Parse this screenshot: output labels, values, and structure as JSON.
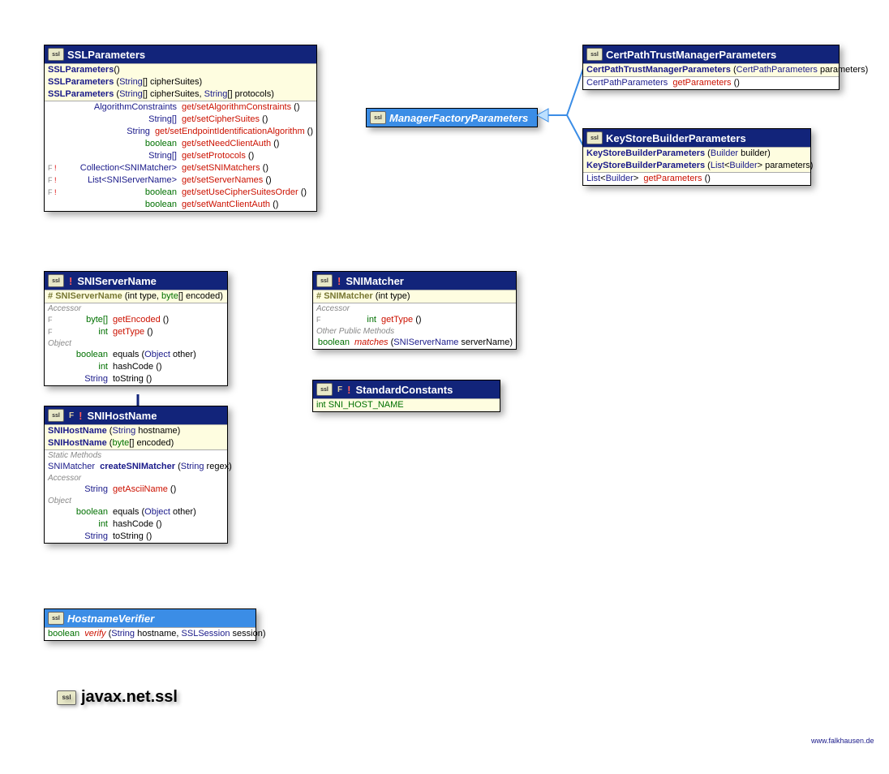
{
  "package": "javax.net.ssl",
  "siteLink": "www.falkhausen.de",
  "classes": {
    "sslParameters": {
      "title": "SSLParameters",
      "constructors": [
        {
          "name": "SSLParameters",
          "params": "()"
        },
        {
          "name": "SSLParameters",
          "params": "(String[] cipherSuites)",
          "p1": "(",
          "t1": "String",
          "p2": "[] cipherSuites)"
        },
        {
          "name": "SSLParameters",
          "params": "(String[] cipherSuites, String[] protocols)",
          "p1": "(",
          "t1": "String",
          "p2": "[] cipherSuites, ",
          "t2": "String",
          "p3": "[] protocols)"
        }
      ],
      "methods": [
        {
          "flags": "",
          "ret": "AlgorithmConstraints",
          "retClass": "link",
          "name": "get/setAlgorithmConstraints",
          "paren": " ()"
        },
        {
          "flags": "",
          "ret": "String[]",
          "retClass": "link",
          "name": "get/setCipherSuites",
          "paren": " ()"
        },
        {
          "flags": "",
          "ret": "String",
          "retClass": "link",
          "name": "get/setEndpointIdentificationAlgorithm",
          "paren": " ()"
        },
        {
          "flags": "",
          "ret": "boolean",
          "retClass": "green",
          "name": "get/setNeedClientAuth",
          "paren": " ()"
        },
        {
          "flags": "",
          "ret": "String[]",
          "retClass": "link",
          "name": "get/setProtocols",
          "paren": " ()"
        },
        {
          "flags": "F!",
          "ret": "Collection<SNIMatcher>",
          "retClass": "link",
          "name": "get/setSNIMatchers",
          "paren": " ()"
        },
        {
          "flags": "F!",
          "ret": "List<SNIServerName>",
          "retClass": "link",
          "name": "get/setServerNames",
          "paren": " ()"
        },
        {
          "flags": "F!",
          "ret": "boolean",
          "retClass": "green",
          "name": "get/setUseCipherSuitesOrder",
          "paren": " ()"
        },
        {
          "flags": "",
          "ret": "boolean",
          "retClass": "green",
          "name": "get/setWantClientAuth",
          "paren": " ()"
        }
      ]
    },
    "managerFactoryParameters": {
      "title": "ManagerFactoryParameters"
    },
    "certPath": {
      "title": "CertPathTrustManagerParameters",
      "ctor": {
        "name": "CertPathTrustManagerParameters",
        "t1": "CertPathParameters",
        "rest": " parameters)"
      },
      "method": {
        "ret": "CertPathParameters",
        "name": "getParameters",
        "paren": " ()"
      }
    },
    "keyStore": {
      "title": "KeyStoreBuilderParameters",
      "ctors": [
        {
          "name": "KeyStoreBuilderParameters",
          "p": "(",
          "t": "Builder",
          "rest": " builder)"
        },
        {
          "name": "KeyStoreBuilderParameters",
          "p": "(",
          "t": "List<Builder>",
          "rest": " parameters)"
        }
      ],
      "method": {
        "ret": "List<Builder>",
        "name": "getParameters",
        "paren": " ()"
      }
    },
    "sniServerName": {
      "title": "SNIServerName",
      "ctor": {
        "name": "SNIServerName",
        "p": "(int type, ",
        "t": "byte",
        "rest": "[] encoded)"
      },
      "acc": [
        {
          "flags": "F",
          "ret": "byte[]",
          "name": "getEncoded",
          "retClass": "green"
        },
        {
          "flags": "F",
          "ret": "int",
          "name": "getType",
          "retClass": "green"
        }
      ],
      "obj": [
        {
          "ret": "boolean",
          "name": "equals",
          "p": "(",
          "t": "Object",
          "rest": " other)"
        },
        {
          "ret": "int",
          "name": "hashCode",
          "paren": " ()"
        },
        {
          "ret": "String",
          "name": "toString",
          "paren": " ()",
          "retClass": "link"
        }
      ]
    },
    "sniHostName": {
      "title": "SNIHostName",
      "ctors": [
        {
          "name": "SNIHostName",
          "p": "(",
          "t": "String",
          "rest": " hostname)"
        },
        {
          "name": "SNIHostName",
          "p": "(",
          "t": "byte",
          "rest": "[] encoded)"
        }
      ],
      "static": {
        "ret": "SNIMatcher",
        "name": "createSNIMatcher",
        "p": "(",
        "t": "String",
        "rest": " regex)"
      },
      "acc": {
        "ret": "String",
        "name": "getAsciiName",
        "paren": " ()",
        "retClass": "link"
      },
      "obj": [
        {
          "ret": "boolean",
          "name": "equals",
          "p": "(",
          "t": "Object",
          "rest": " other)"
        },
        {
          "ret": "int",
          "name": "hashCode",
          "paren": " ()"
        },
        {
          "ret": "String",
          "name": "toString",
          "paren": " ()",
          "retClass": "link"
        }
      ]
    },
    "sniMatcher": {
      "title": "SNIMatcher",
      "ctor": {
        "name": "SNIMatcher",
        "rest": "(int type)"
      },
      "acc": {
        "flags": "F",
        "ret": "int",
        "name": "getType",
        "paren": " ()",
        "retClass": "green"
      },
      "other": {
        "ret": "boolean",
        "name": "matches",
        "p": "(",
        "t": "SNIServerName",
        "rest": " serverName)"
      }
    },
    "standardConstants": {
      "title": "StandardConstants",
      "field": {
        "ret": "int",
        "name": "SNI_HOST_NAME"
      }
    },
    "hostnameVerifier": {
      "title": "HostnameVerifier",
      "method": {
        "ret": "boolean",
        "name": "verify",
        "p": "(",
        "t": "String",
        "mid": " hostname, ",
        "t2": "SSLSession",
        "rest": " session)"
      }
    }
  },
  "labels": {
    "accessor": "Accessor",
    "object": "Object",
    "staticMethods": "Static Methods",
    "otherPublic": "Other Public Methods"
  }
}
